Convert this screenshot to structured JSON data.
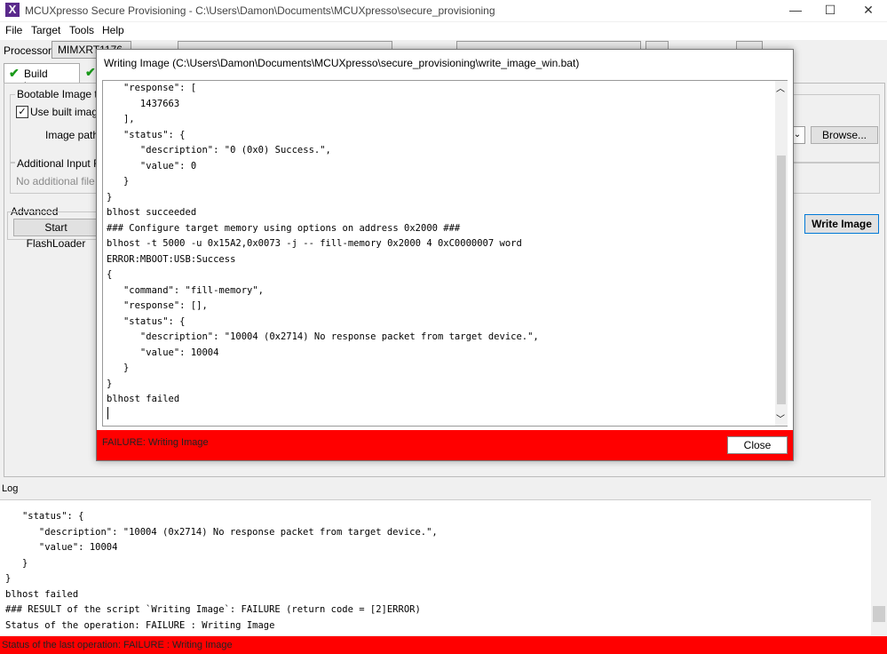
{
  "window": {
    "title": "MCUXpresso Secure Provisioning - C:\\Users\\Damon\\Documents\\MCUXpresso\\secure_provisioning",
    "minimize": "—",
    "maximize": "☐",
    "close": "✕"
  },
  "menu": {
    "items": [
      "File",
      "Target",
      "Tools",
      "Help"
    ]
  },
  "toolbar": {
    "processor_label": "Processor:",
    "processor_value": "MIMXRT1176"
  },
  "tabs": {
    "build_image": "Build image"
  },
  "build_panel": {
    "bootable_image_label": "Bootable Image to",
    "use_built_image": "Use built image",
    "image_path_label": "Image path:",
    "browse": "Browse...",
    "additional_input_label": "Additional Input Fi",
    "no_additional_file": "No additional file u",
    "advanced_label": "Advanced",
    "start_flashloader": "Start FlashLoader",
    "write_image": "Write Image"
  },
  "dialog": {
    "title": "Writing Image (C:\\Users\\Damon\\Documents\\MCUXpresso\\secure_provisioning\\write_image_win.bat)",
    "output": "   \"response\": [\n      1437663\n   ],\n   \"status\": {\n      \"description\": \"0 (0x0) Success.\",\n      \"value\": 0\n   }\n}\nblhost succeeded\n### Configure target memory using options on address 0x2000 ###\nblhost -t 5000 -u 0x15A2,0x0073 -j -- fill-memory 0x2000 4 0xC0000007 word\nERROR:MBOOT:USB:Success\n{\n   \"command\": \"fill-memory\",\n   \"response\": [],\n   \"status\": {\n      \"description\": \"10004 (0x2714) No response packet from target device.\",\n      \"value\": 10004\n   }\n}\nblhost failed",
    "status": "FAILURE: Writing Image",
    "close": "Close",
    "scroll_up": "︿",
    "scroll_down": "﹀"
  },
  "log": {
    "label": "Log",
    "output": "   \"status\": {\n      \"description\": \"10004 (0x2714) No response packet from target device.\",\n      \"value\": 10004\n   }\n}\nblhost failed\n### RESULT of the script `Writing Image`: FAILURE (return code = [2]ERROR)\nStatus of the operation: FAILURE : Writing Image"
  },
  "status_bar": {
    "text": "Status of the last operation: FAILURE : Writing Image"
  },
  "colors": {
    "failure_red": "#ff0000",
    "check_green": "#1a9a1a"
  },
  "icons": {
    "app": "mcuxpresso-x-icon",
    "check": "check-icon",
    "dropdown": "chevron-down-icon"
  }
}
